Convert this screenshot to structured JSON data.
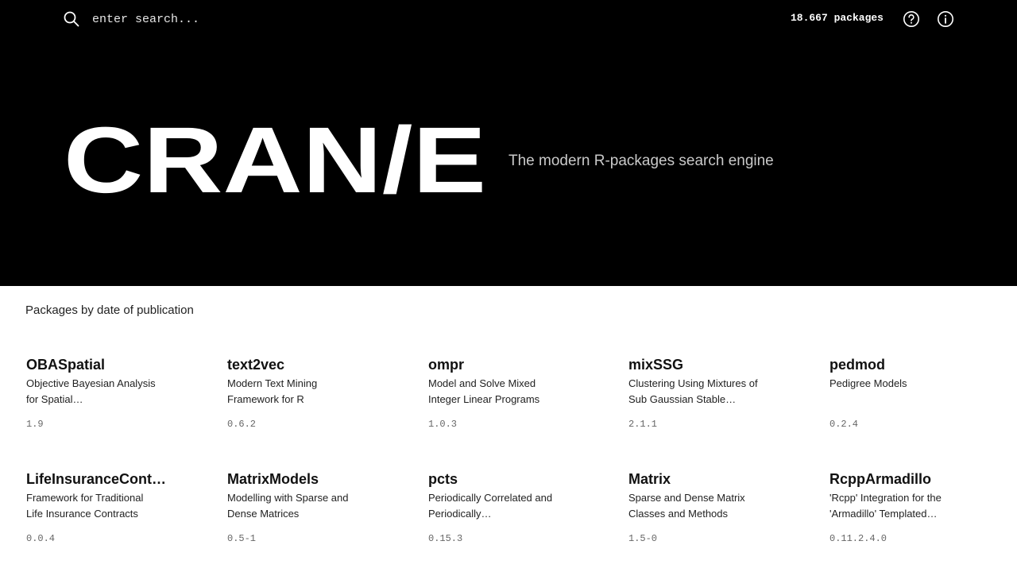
{
  "header": {
    "search_placeholder": "enter search...",
    "package_count": "18.667 packages",
    "help_icon": "help-circle-icon",
    "info_icon": "info-circle-icon",
    "search_icon": "search-icon"
  },
  "hero": {
    "logo_text": "CRAN/E",
    "tagline": "The modern R-packages search engine"
  },
  "section": {
    "title": "Packages by date of publication"
  },
  "packages": [
    {
      "name": "OBASpatial",
      "description": "Objective Bayesian Analysis for Spatial…",
      "version": "1.9"
    },
    {
      "name": "text2vec",
      "description": "Modern Text Mining Framework for R",
      "version": "0.6.2"
    },
    {
      "name": "ompr",
      "description": "Model and Solve Mixed Integer Linear Programs",
      "version": "1.0.3"
    },
    {
      "name": "mixSSG",
      "description": "Clustering Using Mixtures of Sub Gaussian Stable…",
      "version": "2.1.1"
    },
    {
      "name": "pedmod",
      "description": "Pedigree Models",
      "version": "0.2.4"
    },
    {
      "name": "LifeInsuranceCont…",
      "description": "Framework for Traditional Life Insurance Contracts",
      "version": "0.0.4"
    },
    {
      "name": "MatrixModels",
      "description": "Modelling with Sparse and Dense Matrices",
      "version": "0.5-1"
    },
    {
      "name": "pcts",
      "description": "Periodically Correlated and Periodically…",
      "version": "0.15.3"
    },
    {
      "name": "Matrix",
      "description": "Sparse and Dense Matrix Classes and Methods",
      "version": "1.5-0"
    },
    {
      "name": "RcppArmadillo",
      "description": "'Rcpp' Integration for the 'Armadillo' Templated…",
      "version": "0.11.2.4.0"
    }
  ],
  "colors": {
    "hero_background": "#000000",
    "page_background": "#ffffff",
    "logo": "#ffffff",
    "tagline": "#c9c9c9"
  }
}
